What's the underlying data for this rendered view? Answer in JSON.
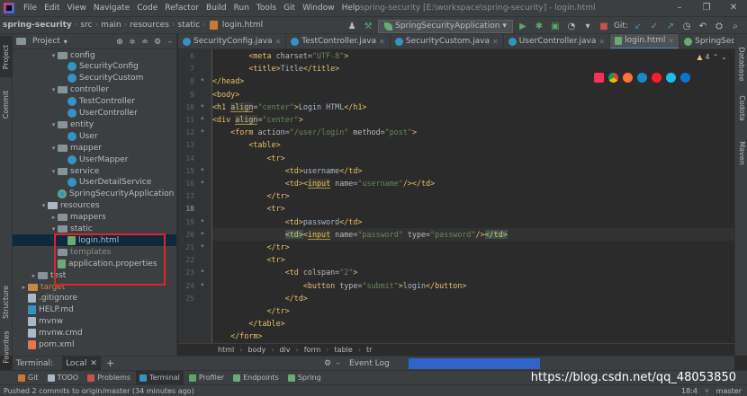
{
  "menu": {
    "items": [
      "File",
      "Edit",
      "View",
      "Navigate",
      "Code",
      "Refactor",
      "Build",
      "Run",
      "Tools",
      "Git",
      "Window",
      "Help"
    ],
    "window_title": "spring-security [E:\\workspace\\spring-security] - login.html"
  },
  "nav": {
    "crumbs": [
      "spring-security",
      "src",
      "main",
      "resources",
      "static",
      "login.html"
    ],
    "run_config": "SpringSecurityApplication",
    "git_label": "Git:"
  },
  "left_strip": {
    "project": "Project",
    "commit": "Commit",
    "structure": "Structure",
    "favorites": "Favorites"
  },
  "right_strip": {
    "database": "Database",
    "codota": "Codota",
    "maven": "Maven"
  },
  "project_panel": {
    "title": "Project",
    "tree": [
      {
        "label": "config",
        "type": "package",
        "indent": 3,
        "arrow": "▾"
      },
      {
        "label": "SecurityConfig",
        "type": "class",
        "indent": 4,
        "arrow": ""
      },
      {
        "label": "SecurityCustom",
        "type": "class",
        "indent": 4,
        "arrow": ""
      },
      {
        "label": "controller",
        "type": "package",
        "indent": 3,
        "arrow": "▾"
      },
      {
        "label": "TestController",
        "type": "class",
        "indent": 4,
        "arrow": ""
      },
      {
        "label": "UserController",
        "type": "class",
        "indent": 4,
        "arrow": ""
      },
      {
        "label": "entity",
        "type": "package",
        "indent": 3,
        "arrow": "▾"
      },
      {
        "label": "User",
        "type": "class",
        "indent": 4,
        "arrow": ""
      },
      {
        "label": "mapper",
        "type": "package",
        "indent": 3,
        "arrow": "▾"
      },
      {
        "label": "UserMapper",
        "type": "class",
        "indent": 4,
        "arrow": ""
      },
      {
        "label": "service",
        "type": "package",
        "indent": 3,
        "arrow": "▾"
      },
      {
        "label": "UserDetailService",
        "type": "class",
        "indent": 4,
        "arrow": ""
      },
      {
        "label": "SpringSecurityApplication",
        "type": "spring",
        "indent": 3,
        "arrow": ""
      },
      {
        "label": "resources",
        "type": "resfolder",
        "indent": 2,
        "arrow": "▾"
      },
      {
        "label": "mappers",
        "type": "folder",
        "indent": 3,
        "arrow": "▸"
      },
      {
        "label": "static",
        "type": "folder",
        "indent": 3,
        "arrow": "▾"
      },
      {
        "label": "login.html",
        "type": "html",
        "indent": 4,
        "arrow": "",
        "selected": true
      },
      {
        "label": "templates",
        "type": "folder",
        "indent": 3,
        "arrow": ""
      },
      {
        "label": "application.properties",
        "type": "prop",
        "indent": 3,
        "arrow": ""
      },
      {
        "label": "test",
        "type": "folder",
        "indent": 1,
        "arrow": "▸"
      },
      {
        "label": "target",
        "type": "orange",
        "indent": 0,
        "arrow": "▸"
      },
      {
        "label": ".gitignore",
        "type": "file",
        "indent": 0,
        "arrow": ""
      },
      {
        "label": "HELP.md",
        "type": "md",
        "indent": 0,
        "arrow": ""
      },
      {
        "label": "mvnw",
        "type": "file",
        "indent": 0,
        "arrow": ""
      },
      {
        "label": "mvnw.cmd",
        "type": "file",
        "indent": 0,
        "arrow": ""
      },
      {
        "label": "pom.xml",
        "type": "xml",
        "indent": 0,
        "arrow": ""
      }
    ]
  },
  "editor": {
    "tabs": [
      {
        "label": "SecurityConfig.java",
        "icon": "class",
        "active": false
      },
      {
        "label": "TestController.java",
        "icon": "class",
        "active": false
      },
      {
        "label": "SecurityCustom.java",
        "icon": "class",
        "active": false
      },
      {
        "label": "UserController.java",
        "icon": "class",
        "active": false
      },
      {
        "label": "login.html",
        "icon": "html",
        "active": true
      },
      {
        "label": "SpringSecurityApplication",
        "icon": "spring",
        "active": false
      }
    ],
    "warning_count": "4",
    "line_numbers": [
      "6",
      "7",
      "8",
      "9",
      "10",
      "11",
      "12",
      "13",
      "14",
      "15",
      "16",
      "17",
      "18",
      "19",
      "20",
      "21",
      "22",
      "23",
      "24",
      "25"
    ],
    "current_line": "18",
    "breadcrumb": [
      "html",
      "body",
      "div",
      "form",
      "table",
      "tr"
    ]
  },
  "terminal": {
    "label": "Terminal:",
    "tab": "Local",
    "event_log": "Event Log"
  },
  "toolbar_bottom": {
    "items": [
      {
        "label": "Git",
        "active": false
      },
      {
        "label": "TODO",
        "active": false
      },
      {
        "label": "Problems",
        "active": false
      },
      {
        "label": "Terminal",
        "active": true
      },
      {
        "label": "Profiler",
        "active": false
      },
      {
        "label": "Endpoints",
        "active": false
      },
      {
        "label": "Spring",
        "active": false
      }
    ]
  },
  "watermark": "https://blog.csdn.net/qq_48053850",
  "status": {
    "message": "Pushed 2 commits to origin/master (34 minutes ago)",
    "position": "18:4",
    "branch": "master"
  },
  "colors": {
    "background": "#2b2b2b",
    "panel": "#3c3f41",
    "tag": "#e8bf6a",
    "attr_value": "#6a8759",
    "selection": "#0d293e",
    "highlight_box": "#e0242b"
  }
}
